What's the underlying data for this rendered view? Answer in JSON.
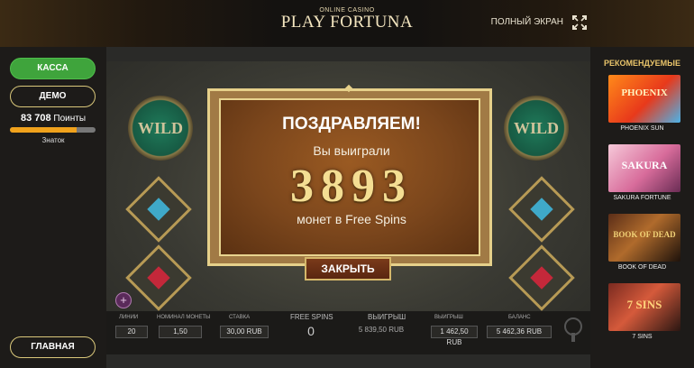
{
  "header": {
    "logo_top": "ONLINE CASINO",
    "logo_main": "PLAY FORTUNA",
    "fullscreen_label": "ПОЛНЫЙ ЭКРАН"
  },
  "sidebar_left": {
    "cashier_label": "КАССА",
    "demo_label": "ДЕМО",
    "points_value": "83 708",
    "points_label": "Поинты",
    "progress_percent": 78,
    "rank_label": "Знаток",
    "home_label": "ГЛАВНАЯ"
  },
  "sidebar_right": {
    "title": "РЕКОМЕНДУЕМЫЕ",
    "games": [
      {
        "label": "PHOENIX SUN",
        "art": "PHOENIX"
      },
      {
        "label": "SAKURA FORTUNE",
        "art": "SAKURA"
      },
      {
        "label": "BOOK OF DEAD",
        "art": "BOOK OF DEAD"
      },
      {
        "label": "7 SINS",
        "art": "7 SINS"
      }
    ]
  },
  "slot": {
    "wild_label": "WILD",
    "stats": [
      {
        "label": "ЛИНИИ",
        "value": "20"
      },
      {
        "label": "НОМИНАЛ МОНЕТЫ",
        "value": "1,50"
      },
      {
        "label": "СТАВКА",
        "value": "30,00 RUB"
      },
      {
        "label": "FREE SPINS",
        "value": "0"
      },
      {
        "label": "ВЫИГРЫШ",
        "value": "5 839,50 RUB"
      },
      {
        "label": "ВЫИГРЫШ",
        "value": "1 462,50 RUB"
      },
      {
        "label": "БАЛАНС",
        "value": "5 462,36 RUB"
      }
    ]
  },
  "modal": {
    "title": "ПОЗДРАВЛЯЕМ!",
    "subtitle": "Вы выиграли",
    "amount": "3893",
    "description": "монет в Free Spins",
    "close_label": "ЗАКРЫТЬ"
  }
}
